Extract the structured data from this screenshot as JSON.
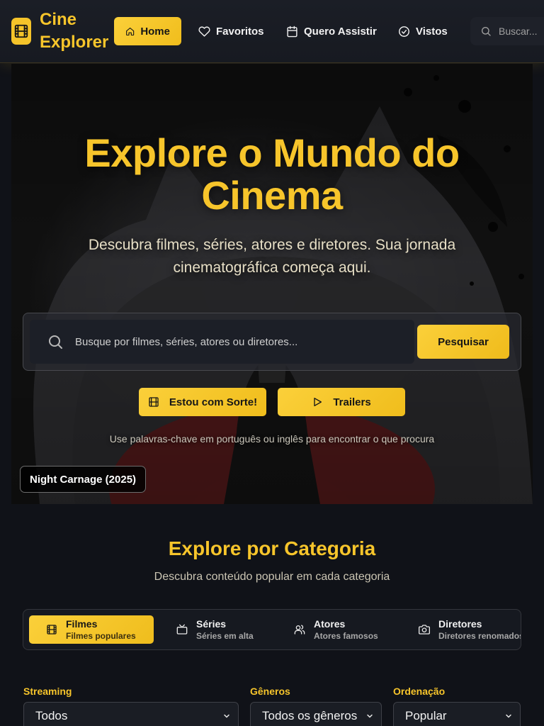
{
  "app": {
    "brand_line1": "Cine",
    "brand_line2": "Explorer"
  },
  "nav": {
    "items": [
      {
        "label": "Home",
        "icon": "home-icon",
        "active": true
      },
      {
        "label": "Favoritos",
        "icon": "heart-icon"
      },
      {
        "label": "Quero Assistir",
        "icon": "calendar-icon"
      },
      {
        "label": "Vistos",
        "icon": "check-circle-icon"
      }
    ],
    "search_placeholder": "Buscar..."
  },
  "hero": {
    "title": "Explore o Mundo do Cinema",
    "subtitle": "Descubra filmes, séries, atores e diretores. Sua jornada cinematográfica começa aqui.",
    "search_placeholder": "Busque por filmes, séries, atores ou diretores...",
    "search_button": "Pesquisar",
    "lucky_button": "Estou com Sorte!",
    "trailers_button": "Trailers",
    "hint": "Use palavras-chave em português ou inglês para encontrar o que procura",
    "featured_badge": "Night Carnage (2025)"
  },
  "categories": {
    "title": "Explore por Categoria",
    "subtitle": "Descubra conteúdo popular em cada categoria",
    "tabs": [
      {
        "label": "Filmes",
        "desc": "Filmes populares",
        "icon": "film-icon",
        "active": true
      },
      {
        "label": "Séries",
        "desc": "Séries em alta",
        "icon": "tv-icon"
      },
      {
        "label": "Atores",
        "desc": "Atores famosos",
        "icon": "users-icon"
      },
      {
        "label": "Diretores",
        "desc": "Diretores renomados",
        "icon": "camera-icon"
      }
    ]
  },
  "filters": {
    "streaming": {
      "label": "Streaming",
      "value": "Todos"
    },
    "genres": {
      "label": "Gêneros",
      "value": "Todos os gêneros"
    },
    "order": {
      "label": "Ordenação",
      "value": "Popular"
    }
  },
  "colors": {
    "accent": "#f7c52b",
    "background": "#101218",
    "hero_red": "#a01212"
  }
}
